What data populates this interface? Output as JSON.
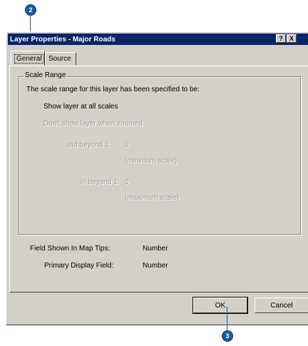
{
  "callouts": {
    "top": "2",
    "bottom": "3"
  },
  "dialog": {
    "title": "Layer Properties - Major Roads",
    "help_btn": "?",
    "close_btn": "X",
    "tabs": [
      {
        "label": "General"
      },
      {
        "label": "Source"
      }
    ],
    "scale_range": {
      "group_title": "Scale Range",
      "intro": "The scale range for this layer has been specified to be:",
      "show_all": "Show layer at all scales",
      "dont_show": "Don't show layer when zoomed:",
      "out_beyond_label": "out beyond 1:",
      "out_beyond_value": "0",
      "out_beyond_hint": "(minimum scale)",
      "in_beyond_label": "in beyond 1:",
      "in_beyond_value": "0",
      "in_beyond_hint": "(maximum scale)"
    },
    "field_map_tips_label": "Field Shown In Map Tips:",
    "field_map_tips_value": "Number",
    "primary_display_label": "Primary Display Field:",
    "primary_display_value": "Number",
    "buttons": {
      "ok": "OK",
      "cancel": "Cancel"
    }
  }
}
